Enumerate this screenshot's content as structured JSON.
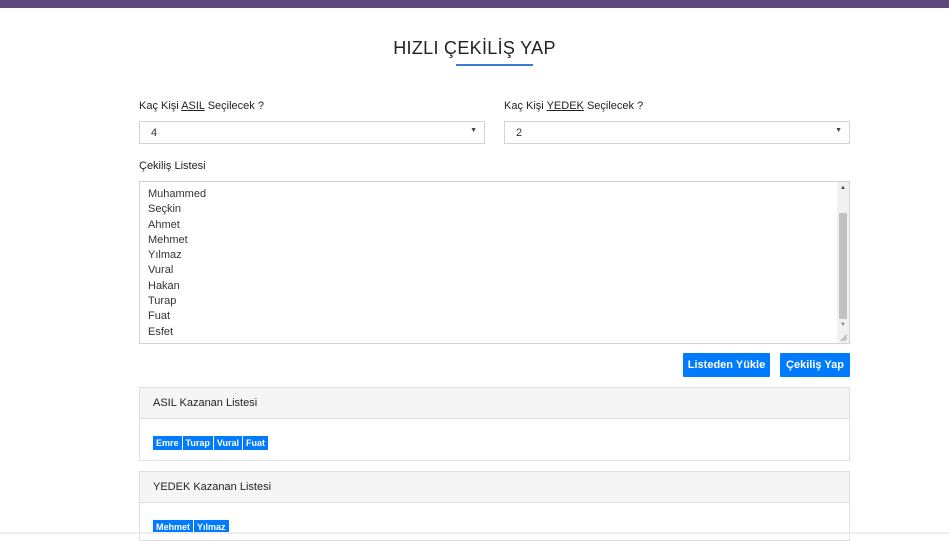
{
  "page": {
    "title": "HIZLI ÇEKİLİŞ YAP",
    "accent_color": "#007bff",
    "topbar_color": "#5c4a7d"
  },
  "form": {
    "asil_label": {
      "prefix": "Kaç Kişi ",
      "underlined": "ASIL",
      "suffix": " Seçilecek ?"
    },
    "yedek_label": {
      "prefix": "Kaç Kişi ",
      "underlined": "YEDEK",
      "suffix": " Seçilecek ?"
    },
    "asil_select_value": "4",
    "yedek_select_value": "2",
    "list_label": "Çekiliş Listesi",
    "list_names": [
      "Muhammed",
      "Seçkin",
      "Ahmet",
      "Mehmet",
      "Yılmaz",
      "Vural",
      "Hakan",
      "Turap",
      "Fuat",
      "Esfet"
    ]
  },
  "buttons": {
    "load_from_list": "Listeden Yükle",
    "draw": "Çekiliş Yap"
  },
  "results": {
    "asil_title": "ASIL Kazanan Listesi",
    "asil_winners": [
      "Emre",
      "Turap",
      "Vural",
      "Fuat"
    ],
    "yedek_title": "YEDEK Kazanan Listesi",
    "yedek_winners": [
      "Mehmet",
      "Yılmaz"
    ]
  }
}
